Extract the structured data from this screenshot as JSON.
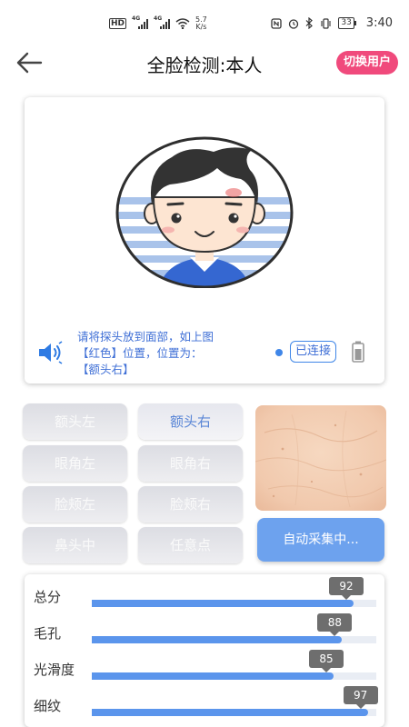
{
  "status_bar": {
    "hd_label": "HD",
    "net1": "4G",
    "net2": "4G",
    "speed_value": "5.7",
    "speed_unit": "K/s",
    "battery": "33",
    "time": "3:40"
  },
  "header": {
    "title": "全脸检测:本人",
    "switch_user": "切换用户"
  },
  "face_card": {
    "instruction_line1": "请将探头放到面部，如上图",
    "instruction_line2": "【红色】位置，位置为：",
    "instruction_line3": "【额头右】",
    "connection_status": "已连接"
  },
  "regions": [
    {
      "label": "额头左",
      "active": false
    },
    {
      "label": "额头右",
      "active": true
    },
    {
      "label": "眼角左",
      "active": false
    },
    {
      "label": "眼角右",
      "active": false
    },
    {
      "label": "脸颊左",
      "active": false
    },
    {
      "label": "脸颊右",
      "active": false
    },
    {
      "label": "鼻头中",
      "active": false
    },
    {
      "label": "任意点",
      "active": false
    }
  ],
  "auto_capture": "自动采集中...",
  "scores": [
    {
      "label": "总分",
      "value": 92
    },
    {
      "label": "毛孔",
      "value": 88
    },
    {
      "label": "光滑度",
      "value": 85
    },
    {
      "label": "细纹",
      "value": 97
    }
  ],
  "colors": {
    "accent": "#5b95ec",
    "switch_button": "#f04a7c",
    "instruction_text": "#3f6fd6"
  }
}
